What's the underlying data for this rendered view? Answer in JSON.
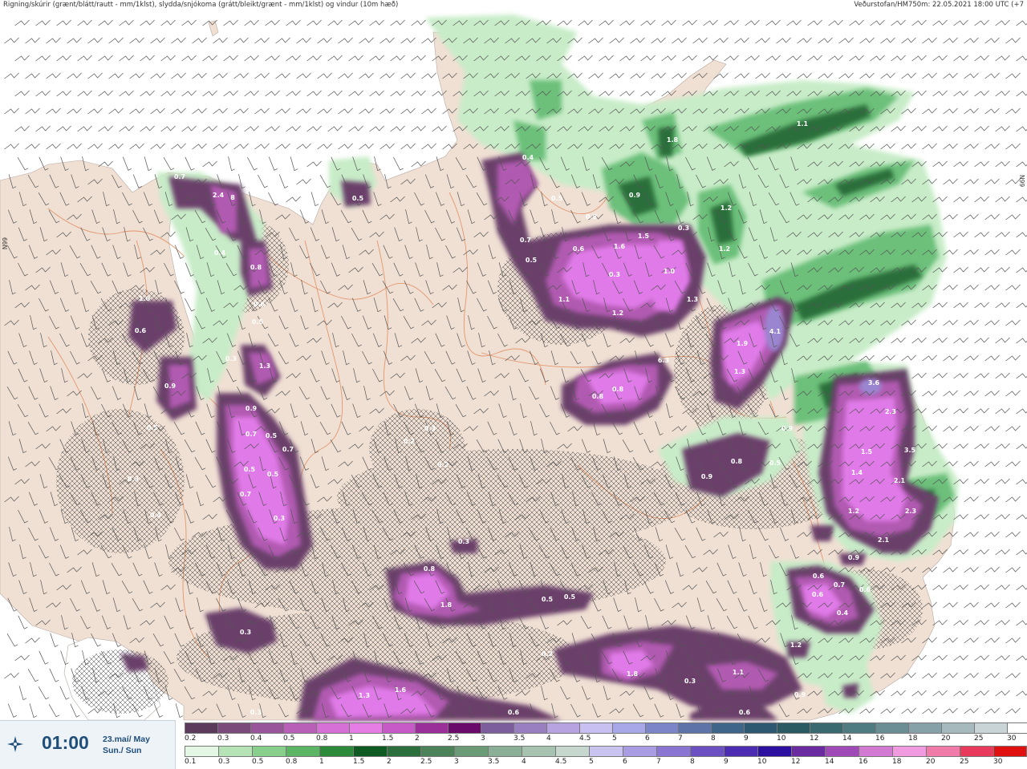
{
  "header": {
    "left_title": "Rigning/skúrir (grænt/blátt/rautt - mm/1klst), slydda/snjókoma (grátt/bleikt/grænt - mm/1klst) og vindur (10m hæð)",
    "right_title": "Veðurstofan/HM750m: 22.05.2021 18:00 UTC (+7"
  },
  "map": {
    "lat_label_left": "N99",
    "lat_label_right": "N99",
    "colors": {
      "sea": "#ffffff",
      "land": "#f0e0d4",
      "roads": "#e08a5c",
      "snow_dark": "#5c3a5c",
      "snow_mid": "#a64ca6",
      "snow_light": "#e070ef",
      "rain_light": "#c8ecc8",
      "rain_mid": "#6cc07a",
      "rain_dark": "#2a6e3a"
    },
    "values": [
      "0.7",
      "2.4",
      "8",
      "0.5",
      "0.4",
      "0.8",
      "0.6",
      "0.5",
      "1.3",
      "0.3",
      "0.9",
      "0.5",
      "0.9",
      "0.7",
      "0.7",
      "0.5",
      "0.5",
      "0.5",
      "0.7",
      "0.3",
      "0.3",
      "0.4",
      "1.0",
      "0.6",
      "0.4",
      "0.5",
      "0.7",
      "0.5",
      "0.8",
      "0.6",
      "1.6",
      "1.5",
      "0.3",
      "1.0",
      "0.3",
      "1.1",
      "1.2",
      "1.3",
      "1.8",
      "0.9",
      "1.1",
      "1.2",
      "1.2",
      "1.9",
      "4.1",
      "1.3",
      "0.9",
      "0.8",
      "0.9",
      "0.8",
      "0.8",
      "6.3",
      "3.6",
      "2.3",
      "1.5",
      "3.5",
      "1.4",
      "2.1",
      "1.2",
      "2.3",
      "2.1",
      "0.9",
      "0.6",
      "0.6",
      "0.3",
      "0.2",
      "0.2",
      "0.3",
      "0.8",
      "1.8",
      "0.5",
      "0.5",
      "0.3",
      "0.2",
      "1.8",
      "0.3",
      "1.1",
      "0.9",
      "1.3",
      "1.6",
      "0.6",
      "0.3",
      "0.7",
      "0.6",
      "0.4",
      "0.5",
      "1.2",
      "0.6",
      "0.5",
      "1.5"
    ]
  },
  "timebox": {
    "icon": "compass-icon",
    "time": "01:00",
    "date_line1": "23.maí/ May",
    "date_line2": "Sun./ Sun"
  },
  "legend": {
    "snow_labels": [
      "0.2",
      "0.3",
      "0.4",
      "0.5",
      "0.8",
      "1",
      "1.5",
      "2",
      "2.5",
      "3",
      "3.5",
      "4",
      "4.5",
      "5",
      "6",
      "7",
      "8",
      "9",
      "10",
      "12",
      "14",
      "16",
      "18",
      "20",
      "25",
      "30"
    ],
    "snow_colors": [
      "#5c3a5c",
      "#7a4a7a",
      "#995599",
      "#b85fb8",
      "#d66fd6",
      "#e57de5",
      "#c85ac8",
      "#9a2f9a",
      "#6a0a6a",
      "#7d5e9c",
      "#9a7fc0",
      "#b7a3e0",
      "#c9c0f2",
      "#a8a8e8",
      "#7c85c8",
      "#5e73a8",
      "#3f6588",
      "#2e5870",
      "#2c5a62",
      "#3a6a70",
      "#4f7c80",
      "#6a8e94",
      "#86a2a8",
      "#a6babe",
      "#c8d4d6",
      "#ffffff"
    ],
    "rain_labels": [
      "0.1",
      "0.3",
      "0.5",
      "0.8",
      "1",
      "1.5",
      "2",
      "2.5",
      "3",
      "3.5",
      "4",
      "4.5",
      "5",
      "6",
      "7",
      "8",
      "9",
      "10",
      "12",
      "14",
      "16",
      "18",
      "20",
      "25",
      "30"
    ],
    "rain_colors": [
      "#e4f6e4",
      "#b6e3b6",
      "#88cf8c",
      "#5cb564",
      "#2d8a3a",
      "#0f5a22",
      "#2c6e3c",
      "#4b8258",
      "#6a9a76",
      "#8aaf96",
      "#a6c2b0",
      "#c6d8ce",
      "#c9c3f0",
      "#a99ce2",
      "#8a76d2",
      "#6b50c2",
      "#4c2cb2",
      "#2e10a0",
      "#6a2aa0",
      "#a04ab8",
      "#d27ad2",
      "#f09ae0",
      "#f07aa8",
      "#e83a5a",
      "#e01010"
    ]
  }
}
